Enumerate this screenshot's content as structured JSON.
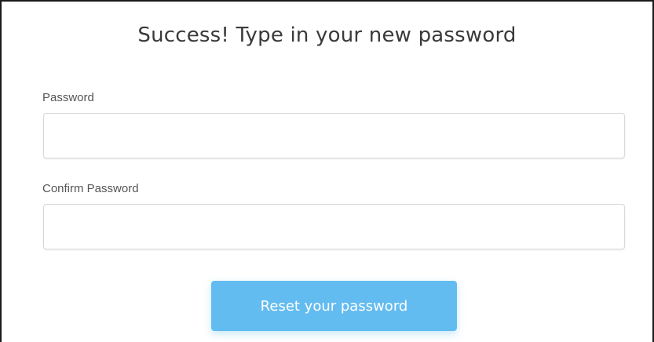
{
  "form": {
    "title": "Success! Type in your new password",
    "password_label": "Password",
    "password_value": "",
    "confirm_label": "Confirm Password",
    "confirm_value": "",
    "submit_label": "Reset your password"
  },
  "colors": {
    "button_background": "#63bcf0",
    "button_text": "#ffffff",
    "title_text": "#3a3a3a",
    "label_text": "#555555",
    "input_border": "#d8d8d8"
  }
}
